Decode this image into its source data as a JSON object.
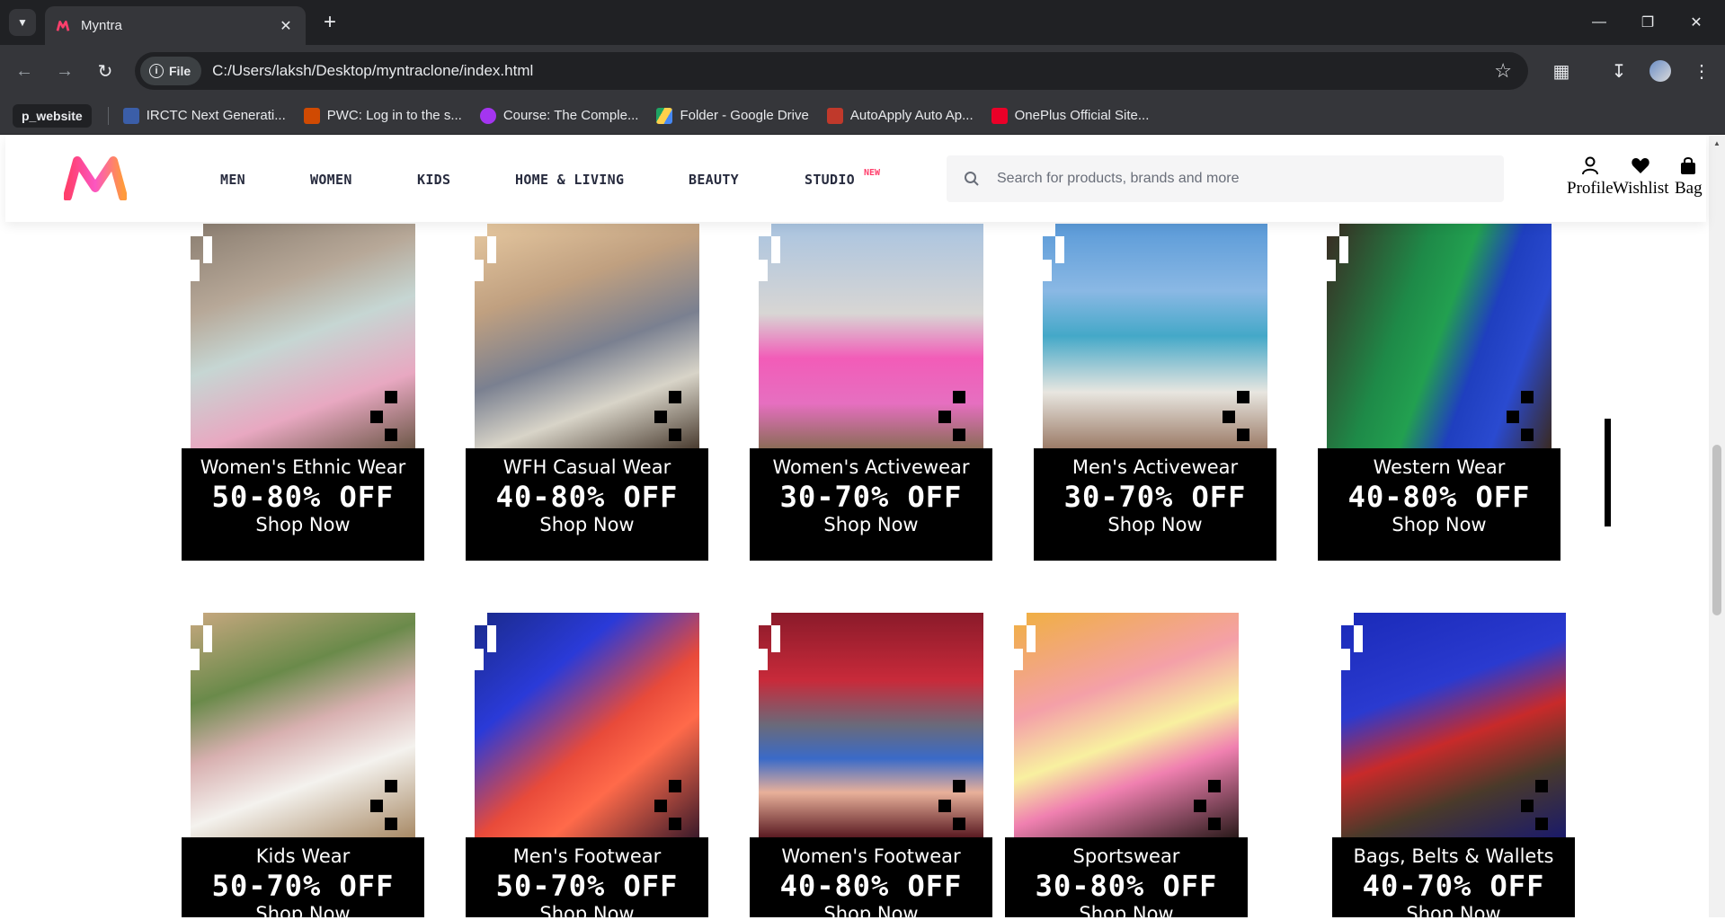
{
  "browser": {
    "tab_title": "Myntra",
    "url_chip": "File",
    "url": "C:/Users/laksh/Desktop/myntraclone/index.html",
    "bookmarks": [
      {
        "label": "p_website",
        "color": "#202124"
      },
      {
        "label": "IRCTC Next Generati...",
        "color": "#3b5ea8"
      },
      {
        "label": "PWC: Log in to the s...",
        "color": "#d04a02"
      },
      {
        "label": "Course: The Comple...",
        "color": "#a435f0"
      },
      {
        "label": "Folder - Google Drive",
        "color": "#1fa463"
      },
      {
        "label": "AutoApply Auto Ap...",
        "color": "#c0392b"
      },
      {
        "label": "OnePlus Official Site...",
        "color": "#eb0028"
      }
    ]
  },
  "header": {
    "nav": [
      "MEN",
      "WOMEN",
      "KIDS",
      "HOME & LIVING",
      "BEAUTY",
      "STUDIO"
    ],
    "new_badge": "NEW",
    "search_placeholder": "Search for products, brands and more",
    "actions": [
      "Profile",
      "Wishlist",
      "Bag"
    ]
  },
  "cards": [
    {
      "name": "Women's Ethnic Wear",
      "offer": "50-80% OFF",
      "cta": "Shop Now"
    },
    {
      "name": "WFH Casual Wear",
      "offer": "40-80% OFF",
      "cta": "Shop Now"
    },
    {
      "name": "Women's Activewear",
      "offer": "30-70% OFF",
      "cta": "Shop Now"
    },
    {
      "name": "Men's Activewear",
      "offer": "30-70% OFF",
      "cta": "Shop Now"
    },
    {
      "name": "Western Wear",
      "offer": "40-80% OFF",
      "cta": "Shop Now"
    },
    {
      "name": "Kids Wear",
      "offer": "50-70% OFF",
      "cta": "Shop Now"
    },
    {
      "name": "Men's Footwear",
      "offer": "50-70% OFF",
      "cta": "Shop Now"
    },
    {
      "name": "Women's Footwear",
      "offer": "40-80% OFF",
      "cta": "Shop Now"
    },
    {
      "name": "Sportswear",
      "offer": "30-80% OFF",
      "cta": "Shop Now"
    },
    {
      "name": "Bags, Belts & Wallets",
      "offer": "40-70% OFF",
      "cta": "Shop Now"
    }
  ],
  "colors": {
    "brand_pink": "#ff3f6c",
    "brand_orange": "#ff9a3c",
    "panel": "#000000"
  }
}
